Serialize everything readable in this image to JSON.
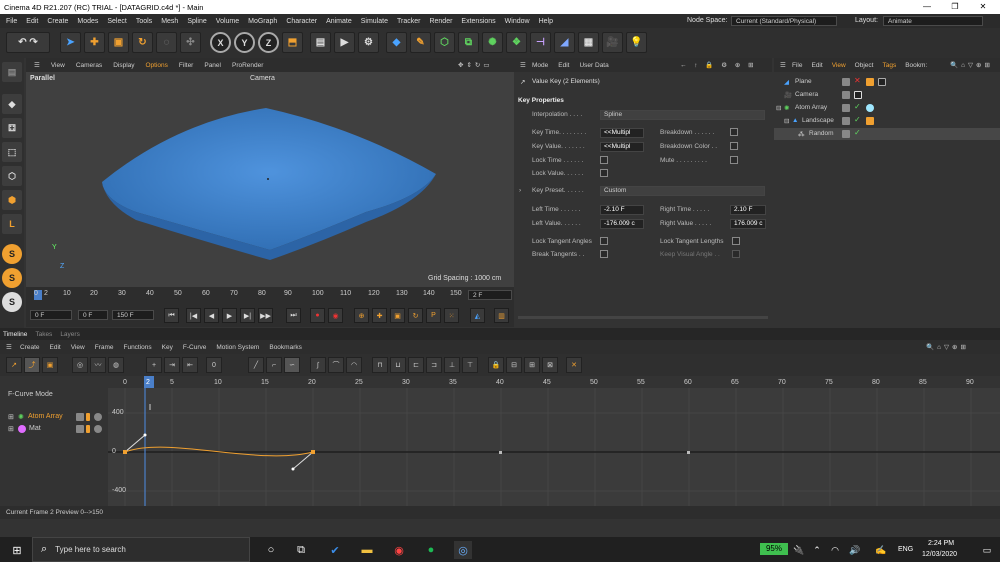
{
  "title_bar": {
    "title": "Cinema 4D R21.207 (RC) TRIAL - [DATAGRID.c4d *] - Main",
    "minimize": "—",
    "maximize": "❐",
    "close": "✕"
  },
  "menu": [
    "File",
    "Edit",
    "Create",
    "Modes",
    "Select",
    "Tools",
    "Mesh",
    "Spline",
    "Volume",
    "MoGraph",
    "Character",
    "Animate",
    "Simulate",
    "Tracker",
    "Render",
    "Extensions",
    "Window",
    "Help"
  ],
  "node_space": {
    "label": "Node Space:",
    "value": "Current (Standard/Physical)"
  },
  "layout": {
    "label": "Layout:",
    "value": "Animate"
  },
  "viewport": {
    "menu": [
      "View",
      "Cameras",
      "Display",
      "Options",
      "Filter",
      "Panel",
      "ProRender"
    ],
    "projection": "Parallel",
    "camera": "Camera",
    "grid_spacing": "Grid Spacing : 1000 cm",
    "axis_y": "Y",
    "axis_z": "Z"
  },
  "ruler_ticks": [
    "0",
    "2",
    "10",
    "20",
    "30",
    "40",
    "50",
    "60",
    "70",
    "80",
    "90",
    "100",
    "110",
    "120",
    "130",
    "140",
    "150"
  ],
  "transport": {
    "start": "0 F",
    "current": "0 F",
    "end": "150 F",
    "frame_field": "2 F"
  },
  "attributes": {
    "menu": [
      "Mode",
      "Edit",
      "User Data"
    ],
    "heading": "Value Key (2 Elements)",
    "section": "Key Properties",
    "interpolation_label": "Interpolation . . . .",
    "interpolation": "Spline",
    "key_time_label": "Key Time. . . . . . . .",
    "key_time": "<<Multipl",
    "key_value_label": "Key Value. . . . . . .",
    "key_value": "<<Multipl",
    "lock_time": "Lock Time . . . . . .",
    "lock_value": "Lock Value. . . . . .",
    "breakdown": "Breakdown . . . . . .",
    "breakdown_color": "Breakdown Color . .",
    "mute": "Mute . . . . . . . . .",
    "key_preset_label": "Key Preset. . . . . .",
    "key_preset": "Custom",
    "left_time_label": "Left Time . . . . . .",
    "left_time": "-2.10 F",
    "right_time_label": "Right Time . . . . .",
    "right_time": "2.10 F",
    "left_value_label": "Left Value. . . . . .",
    "left_value": "-176.009 c",
    "right_value_label": "Right Value . . . . .",
    "right_value": "176.009 c",
    "lock_tangent_angles": "Lock Tangent Angles",
    "lock_tangent_lengths": "Lock Tangent Lengths",
    "break_tangents": "Break Tangents . .",
    "keep_visual_angle": "Keep Visual Angle . ."
  },
  "objects": {
    "menu": [
      "File",
      "Edit",
      "View",
      "Object",
      "Tags",
      "Bookm:"
    ],
    "items": [
      {
        "name": "Plane"
      },
      {
        "name": "Camera"
      },
      {
        "name": "Atom Array"
      },
      {
        "name": "Landscape"
      },
      {
        "name": "Random"
      }
    ]
  },
  "tabs": [
    "Timeline",
    "Takes",
    "Layers"
  ],
  "timeline": {
    "menu": [
      "Create",
      "Edit",
      "View",
      "Frame",
      "Functions",
      "Key",
      "F-Curve",
      "Motion System",
      "Bookmarks"
    ],
    "mode": "F-Curve Mode",
    "tracks": [
      "Atom Array",
      "Mat"
    ],
    "x_ticks": [
      "0",
      "2",
      "5",
      "10",
      "15",
      "20",
      "25",
      "30",
      "35",
      "40",
      "45",
      "50",
      "55",
      "60",
      "65",
      "70",
      "75",
      "80",
      "85",
      "90"
    ],
    "y_ticks": [
      "400",
      "0",
      "-400"
    ],
    "status": "Current Frame  2  Preview  0-->150"
  },
  "taskbar": {
    "search": "Type here to search",
    "battery": "95%",
    "lang": "ENG",
    "time": "2:24 PM",
    "date": "12/03/2020"
  },
  "colors": {
    "accent": "#f0a030",
    "blue_object": "#3f7fc4",
    "key": "#f0a030"
  }
}
